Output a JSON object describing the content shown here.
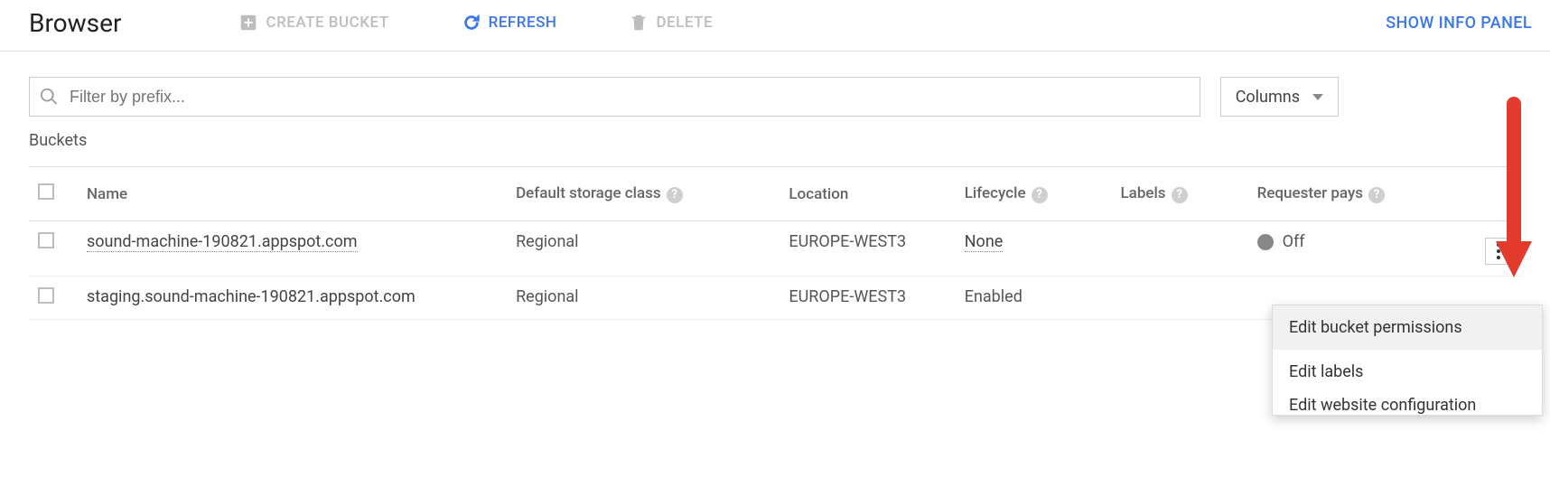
{
  "page_title": "Browser",
  "toolbar": {
    "create_bucket": "CREATE BUCKET",
    "refresh": "REFRESH",
    "delete": "DELETE",
    "show_info_panel": "SHOW INFO PANEL"
  },
  "filter": {
    "placeholder": "Filter by prefix...",
    "columns_label": "Columns"
  },
  "section_label": "Buckets",
  "columns": {
    "name": "Name",
    "default_storage": "Default storage class",
    "location": "Location",
    "lifecycle": "Lifecycle",
    "labels": "Labels",
    "requester_pays": "Requester pays"
  },
  "rows": [
    {
      "name": "sound-machine-190821.appspot.com",
      "default_storage": "Regional",
      "location": "EUROPE-WEST3",
      "lifecycle": "None",
      "labels": "",
      "requester_pays": "Off"
    },
    {
      "name": "staging.sound-machine-190821.appspot.com",
      "default_storage": "Regional",
      "location": "EUROPE-WEST3",
      "lifecycle": "Enabled",
      "labels": "",
      "requester_pays": ""
    }
  ],
  "popup": {
    "edit_permissions": "Edit bucket permissions",
    "edit_labels": "Edit labels",
    "edit_website_cut": "Edit website configuration"
  }
}
